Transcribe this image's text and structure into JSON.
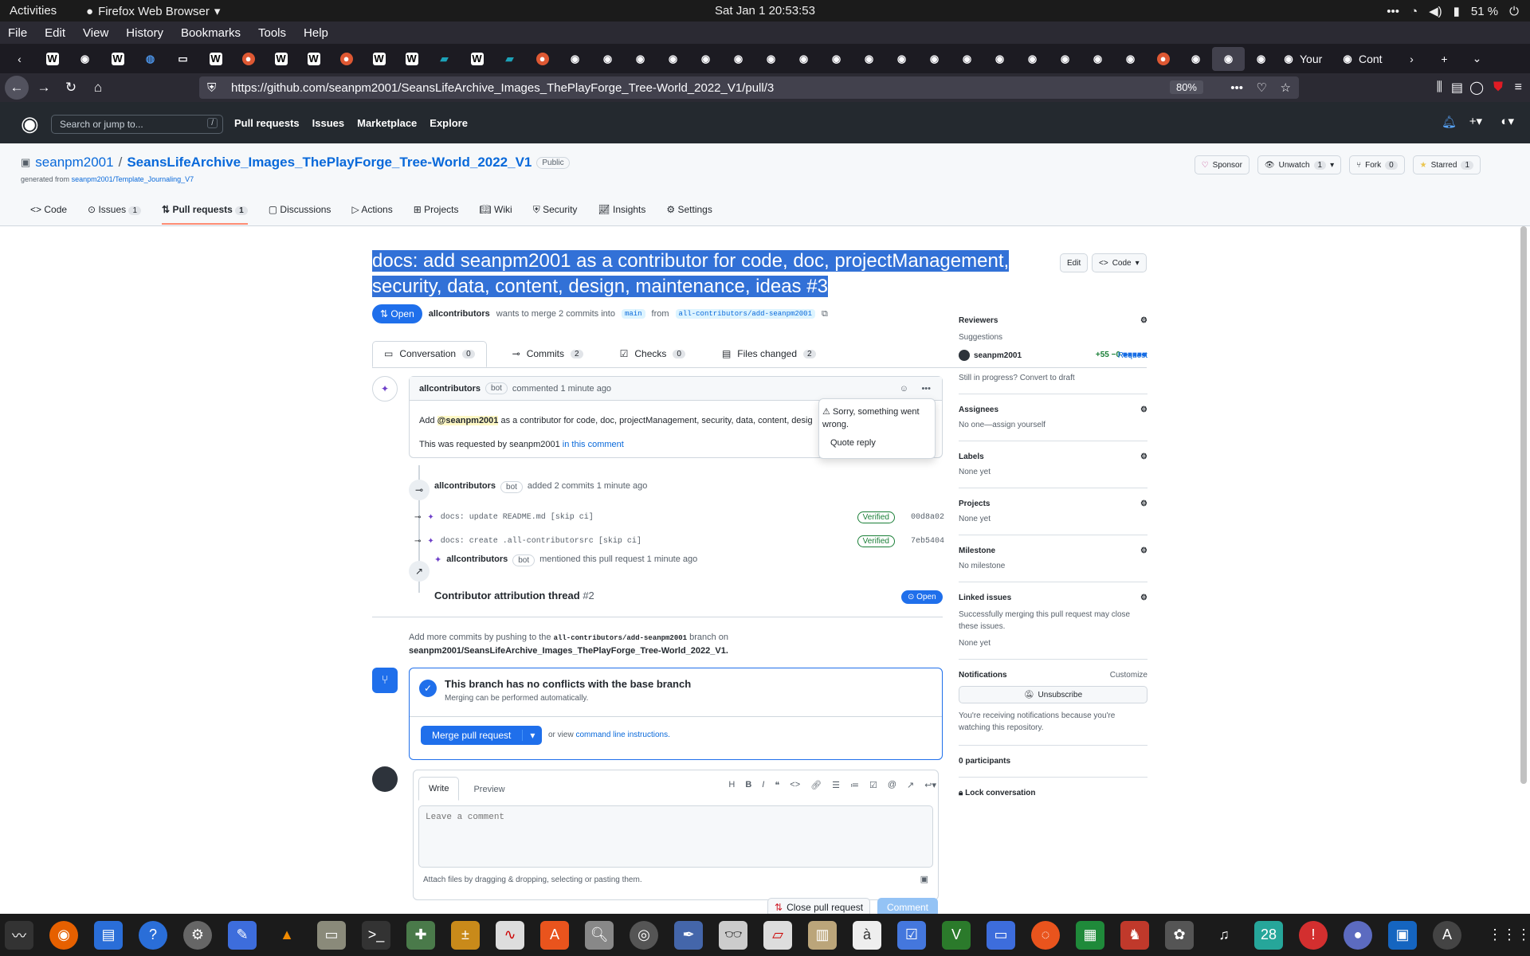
{
  "os": {
    "activities": "Activities",
    "app": "Firefox Web Browser",
    "clock": "Sat Jan 1  20:53:53",
    "battery": "51 %"
  },
  "menu": [
    "File",
    "Edit",
    "View",
    "History",
    "Tools",
    "Help"
  ],
  "tabs": {
    "wide1": "Your",
    "wide2": "Cont"
  },
  "url": {
    "text": "https://github.com/seanpm2001/SeansLifeArchive_Images_ThePlayForge_Tree-World_2022_V1/pull/3",
    "zoom": "80%"
  },
  "gh": {
    "search": "Search or jump to...",
    "nav": [
      "Pull requests",
      "Issues",
      "Marketplace",
      "Explore"
    ]
  },
  "repo": {
    "owner": "seanpm2001",
    "name": "SeansLifeArchive_Images_ThePlayForge_Tree-World_2022_V1",
    "visibility": "Public",
    "generated_prefix": "generated from",
    "template": "seanpm2001/Template_Journaling_V7",
    "buttons": {
      "sponsor": "Sponsor",
      "unwatch": "Unwatch",
      "unwatch_count": "1",
      "fork": "Fork",
      "fork_count": "0",
      "starred": "Starred",
      "star_count": "1"
    },
    "tabs": [
      {
        "label": "Code",
        "count": ""
      },
      {
        "label": "Issues",
        "count": "1"
      },
      {
        "label": "Pull requests",
        "count": "1"
      },
      {
        "label": "Discussions",
        "count": ""
      },
      {
        "label": "Actions",
        "count": ""
      },
      {
        "label": "Projects",
        "count": ""
      },
      {
        "label": "Wiki",
        "count": ""
      },
      {
        "label": "Security",
        "count": ""
      },
      {
        "label": "Insights",
        "count": ""
      },
      {
        "label": "Settings",
        "count": ""
      }
    ]
  },
  "pr": {
    "title": "docs: add seanpm2001 as a contributor for code, doc, projectManagement, security, data, content, design, maintenance, ideas #3",
    "edit": "Edit",
    "code": "Code",
    "state": "Open",
    "author": "allcontributors",
    "merge_text": "wants to merge 2 commits into",
    "base": "main",
    "from": "from",
    "head": "all-contributors/add-seanpm2001",
    "tabs": [
      {
        "label": "Conversation",
        "count": "0"
      },
      {
        "label": "Commits",
        "count": "2"
      },
      {
        "label": "Checks",
        "count": "0"
      },
      {
        "label": "Files changed",
        "count": "2"
      }
    ],
    "diff": "+55 −0"
  },
  "comment": {
    "author": "allcontributors",
    "bot": "bot",
    "time": "commented 1 minute ago",
    "body_pre": "Add",
    "mention": "@seanpm2001",
    "body_post": "as a contributor for code, doc, projectManagement, security, data, content, desig",
    "requested": "This was requested by seanpm2001",
    "link": "in this comment"
  },
  "popup": {
    "error": "Sorry, something went wrong.",
    "quote": "Quote reply"
  },
  "timeline": {
    "author": "allcontributors",
    "bot": "bot",
    "added": "added 2 commits 1 minute ago",
    "commits": [
      {
        "msg": "docs: update README.md [skip ci]",
        "verified": "Verified",
        "sha": "00d8a02"
      },
      {
        "msg": "docs: create .all-contributorsrc [skip ci]",
        "verified": "Verified",
        "sha": "7eb5404"
      }
    ],
    "mention_author": "allcontributors",
    "mention_text": "mentioned this pull request 1 minute ago",
    "ref_title": "Contributor attribution thread",
    "ref_num": "#2",
    "ref_state": "Open"
  },
  "push": {
    "pre": "Add more commits by pushing to the",
    "branch": "all-contributors/add-seanpm2001",
    "post": "branch on",
    "repo": "seanpm2001/SeansLifeArchive_Images_ThePlayForge_Tree-World_2022_V1."
  },
  "merge": {
    "title": "This branch has no conflicts with the base branch",
    "sub": "Merging can be performed automatically.",
    "button": "Merge pull request",
    "or": "or view",
    "cli": "command line instructions."
  },
  "editor": {
    "write": "Write",
    "preview": "Preview",
    "placeholder": "Leave a comment",
    "attach": "Attach files by dragging & dropping, selecting or pasting them.",
    "close": "Close pull request",
    "submit": "Comment"
  },
  "sidebar": {
    "reviewers": "Reviewers",
    "suggestions": "Suggestions",
    "reviewer": "seanpm2001",
    "request": "Request",
    "draft": "Still in progress? Convert to draft",
    "assignees": "Assignees",
    "assign": "No one—assign yourself",
    "labels": "Labels",
    "labels_v": "None yet",
    "projects": "Projects",
    "projects_v": "None yet",
    "milestone": "Milestone",
    "milestone_v": "No milestone",
    "linked": "Linked issues",
    "linked_desc": "Successfully merging this pull request may close these issues.",
    "linked_v": "None yet",
    "notifications": "Notifications",
    "customize": "Customize",
    "unsubscribe": "Unsubscribe",
    "notif_desc": "You're receiving notifications because you're watching this repository.",
    "participants": "0 participants",
    "lock": "Lock conversation"
  },
  "dock": {
    "calendar": "28"
  }
}
